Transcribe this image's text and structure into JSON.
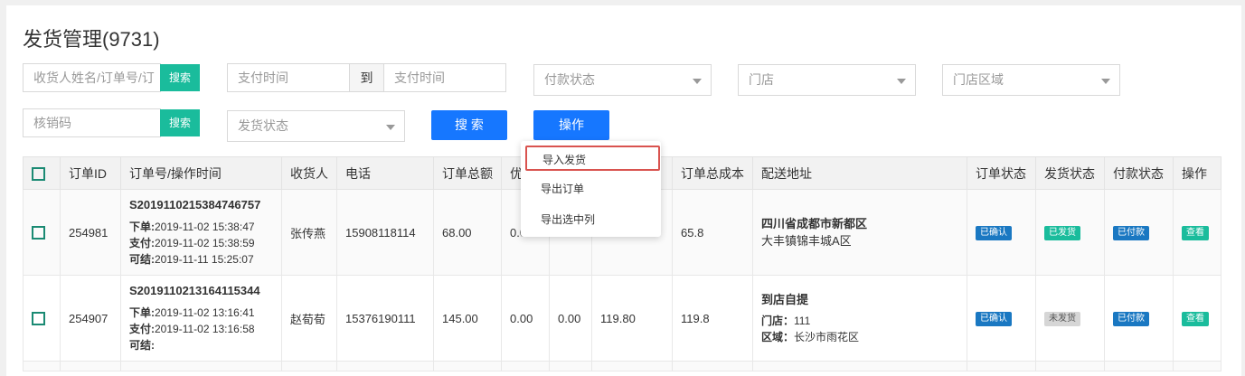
{
  "page": {
    "title": "发货管理(9731)"
  },
  "filters": {
    "search_placeholder": "收货人姓名/订单号/订",
    "search_btn": "搜索",
    "pay_time_start_placeholder": "支付时间",
    "to_label": "到",
    "pay_time_end_placeholder": "支付时间",
    "pay_status_placeholder": "付款状态",
    "store_placeholder": "门店",
    "store_area_placeholder": "门店区域",
    "verify_code_placeholder": "核销码",
    "verify_search_btn": "搜索",
    "ship_status_placeholder": "发货状态",
    "main_search_btn": "搜 索",
    "action_btn": "操作"
  },
  "action_menu": {
    "items": [
      "导入发货",
      "导出订单",
      "导出选中列"
    ]
  },
  "table": {
    "headers": [
      "订单ID",
      "订单号/操作时间",
      "收货人",
      "电话",
      "订单总额",
      "优惠",
      "",
      "",
      "订单总成本",
      "配送地址",
      "订单状态",
      "发货状态",
      "付款状态",
      "操作"
    ],
    "rows": [
      {
        "id": "254981",
        "order_no": "S20191102153847467​57",
        "t1_label": "下单:",
        "t1": "2019-11-02 15:38:47",
        "t2_label": "支付:",
        "t2": "2019-11-02 15:38:59",
        "t3_label": "可结:",
        "t3": "2019-11-11 15:25:07",
        "receiver": "张传燕",
        "phone": "15908118114",
        "total": "68.00",
        "discount": "0.0",
        "c7": "",
        "c8": "",
        "cost": "65.8",
        "addr_line1": "四川省成都市新都区",
        "addr_line2": "大丰镇锦丰城A区",
        "order_status": "已确认",
        "ship_status": "已发货",
        "pay_status": "已付款",
        "action": "查看"
      },
      {
        "id": "254907",
        "order_no": "S2019110213164115344",
        "t1_label": "下单:",
        "t1": "2019-11-02 13:16:41",
        "t2_label": "支付:",
        "t2": "2019-11-02 13:16:58",
        "t3_label": "可结:",
        "t3": "",
        "receiver": "赵荀荀",
        "phone": "15376190111",
        "total": "145.00",
        "discount": "0.00",
        "c7": "0.00",
        "c8": "119.80",
        "cost": "119.8",
        "addr_title": "到店自提",
        "store_label": "门店：",
        "store_val": "111",
        "area_label": "区域：",
        "area_val": "长沙市雨花区",
        "order_status": "已确认",
        "ship_status": "未发货",
        "pay_status": "已付款",
        "action": "查看"
      }
    ]
  },
  "colors": {
    "primary_blue": "#1677ff",
    "green": "#1abc9c",
    "badge_blue": "#1a78c2",
    "highlight_red": "#d9534f"
  }
}
